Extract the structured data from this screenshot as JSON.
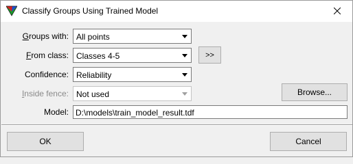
{
  "window": {
    "title": "Classify Groups Using Trained Model",
    "app_icon": "terrasolid-triangle-icon",
    "close_icon": "close-x-icon"
  },
  "form": {
    "groups_with": {
      "label_accel": "G",
      "label_rest": "roups with:",
      "value": "All points"
    },
    "from_class": {
      "label_accel": "F",
      "label_rest": "rom class:",
      "value": "Classes 4-5",
      "more_button": ">>"
    },
    "confidence": {
      "label": "Confidence:",
      "value": "Reliability"
    },
    "inside_fence": {
      "label_accel": "I",
      "label_rest": "nside fence:",
      "value": "Not used",
      "enabled": false
    },
    "browse_button": "Browse...",
    "model": {
      "label": "Model:",
      "value": "D:\\models\\train_model_result.tdf"
    }
  },
  "footer": {
    "ok_label": "OK",
    "cancel_label": "Cancel"
  },
  "colors": {
    "window_bg": "#f0f0f0",
    "titlebar_bg": "#ffffff",
    "button_bg": "#e1e1e1",
    "disabled_text": "#8a8a8a"
  }
}
